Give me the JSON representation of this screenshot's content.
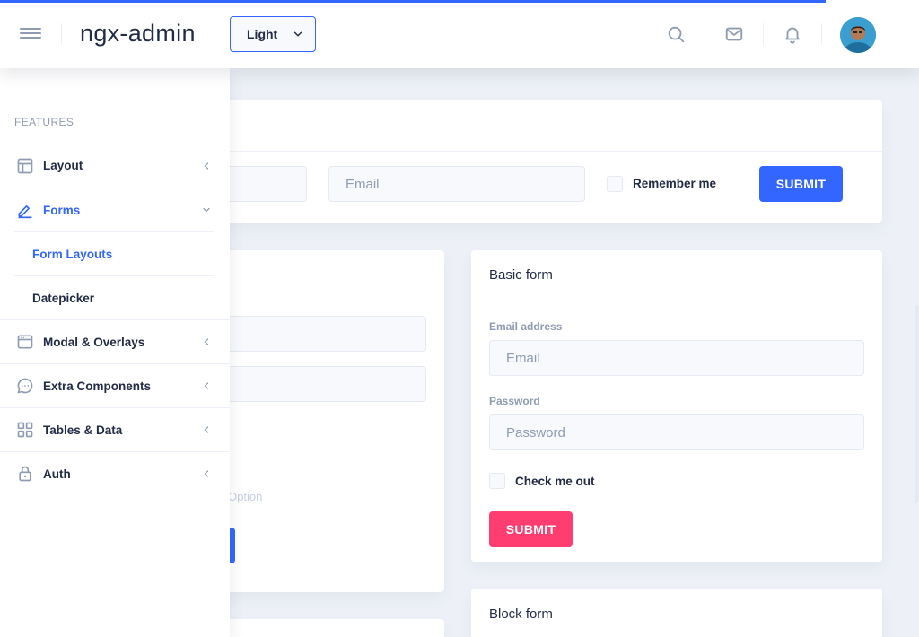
{
  "header": {
    "logo": "ngx-admin",
    "theme": {
      "selected": "Light"
    },
    "icons": [
      "search-icon",
      "mail-icon",
      "bell-icon"
    ],
    "accent": "#3366ff"
  },
  "sidebar": {
    "section_label": "FEATURES",
    "items": [
      {
        "label": "Layout",
        "icon": "layout-icon"
      },
      {
        "label": "Forms",
        "icon": "edit-icon",
        "expanded": true
      },
      {
        "label": "Modal & Overlays",
        "icon": "browser-icon"
      },
      {
        "label": "Extra Components",
        "icon": "message-circle-icon"
      },
      {
        "label": "Tables & Data",
        "icon": "grid-icon"
      },
      {
        "label": "Auth",
        "icon": "lock-icon"
      }
    ],
    "sub_items": [
      {
        "label": "Form Layouts",
        "active": true
      },
      {
        "label": "Datepicker"
      }
    ]
  },
  "inline_form": {
    "email_placeholder": "Email",
    "remember_label": "Remember me",
    "submit_label": "SUBMIT"
  },
  "left_card": {
    "faded_text": "Option"
  },
  "basic_form": {
    "title": "Basic form",
    "email_label": "Email address",
    "email_placeholder": "Email",
    "password_label": "Password",
    "password_placeholder": "Password",
    "checkbox_label": "Check me out",
    "submit_label": "SUBMIT",
    "submit_color": "#ff3d71"
  },
  "block_form": {
    "title": "Block form"
  }
}
